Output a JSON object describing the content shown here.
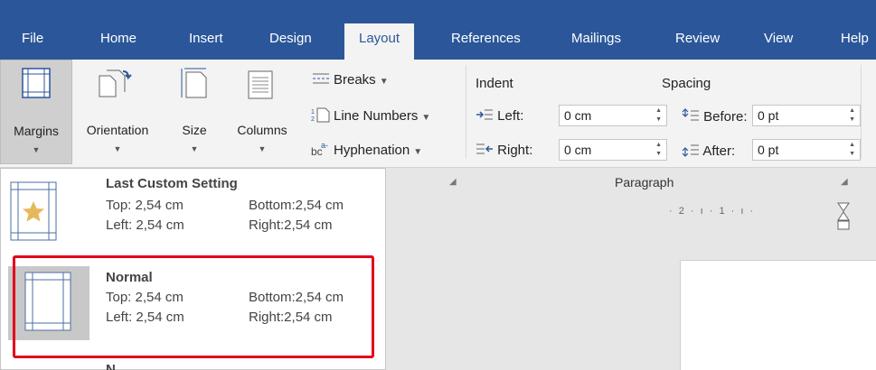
{
  "colors": {
    "tab_bar": "#2b579a",
    "ribbon": "#f3f3f3",
    "highlight": "#e3001b",
    "star": "#e6b85c"
  },
  "tabs": [
    {
      "label": "File"
    },
    {
      "label": "Home"
    },
    {
      "label": "Insert"
    },
    {
      "label": "Design"
    },
    {
      "label": "Layout",
      "active": true
    },
    {
      "label": "References"
    },
    {
      "label": "Mailings"
    },
    {
      "label": "Review"
    },
    {
      "label": "View"
    },
    {
      "label": "Help"
    }
  ],
  "page_setup": {
    "margins": "Margins",
    "orientation": "Orientation",
    "size": "Size",
    "columns": "Columns",
    "breaks": "Breaks",
    "line_numbers": "Line Numbers",
    "hyphenation": "Hyphenation"
  },
  "paragraph": {
    "group_label": "Paragraph",
    "indent_header": "Indent",
    "spacing_header": "Spacing",
    "left_label": "Left:",
    "left_value": "0 cm",
    "right_label": "Right:",
    "right_value": "0 cm",
    "before_label": "Before:",
    "before_value": "0 pt",
    "after_label": "After:",
    "after_value": "0 pt"
  },
  "ruler_text": "· 2 · ı · 1 · ı ·",
  "margins_menu": {
    "options": [
      {
        "name": "Last Custom Setting",
        "top": "Top: 2,54 cm",
        "bottom": "Bottom:2,54 cm",
        "left": "Left: 2,54 cm",
        "right": "Right:2,54 cm",
        "icon": "star-page-icon"
      },
      {
        "name": "Normal",
        "top": "Top: 2,54 cm",
        "bottom": "Bottom:2,54 cm",
        "left": "Left: 2,54 cm",
        "right": "Right:2,54 cm",
        "icon": "page-margins-icon",
        "selected": true
      },
      {
        "name": "N"
      }
    ]
  }
}
